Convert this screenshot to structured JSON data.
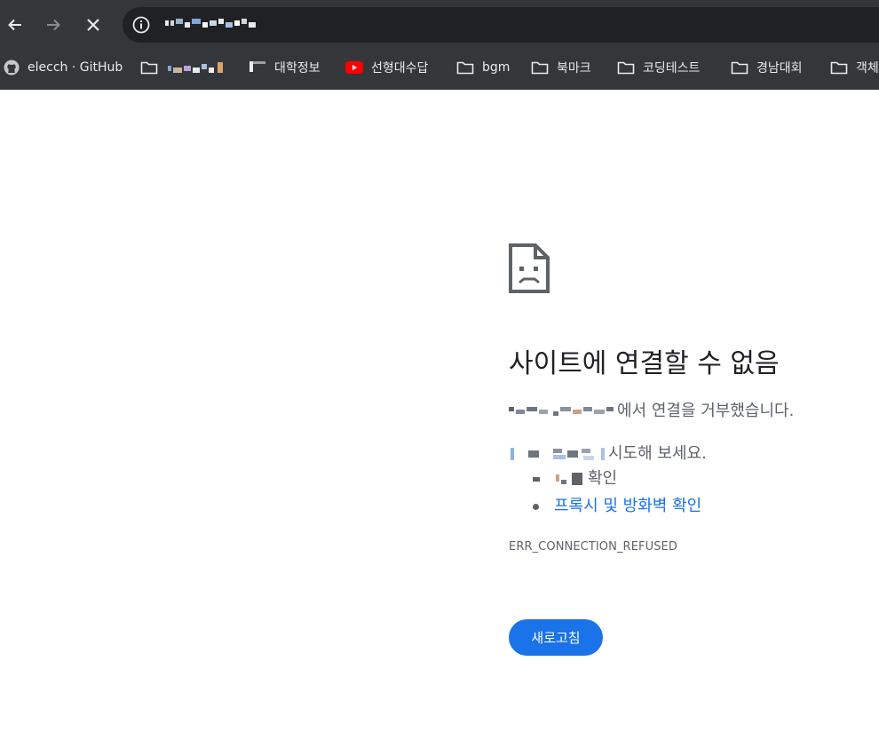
{
  "browser": {
    "url_text": "",
    "back_icon": "arrow-left-icon",
    "forward_icon": "arrow-right-icon",
    "stop_icon": "close-icon",
    "site_info_icon": "info-icon"
  },
  "bookmarks": [
    {
      "label": "elecch · GitHub",
      "icon": "github-icon"
    },
    {
      "label": "",
      "icon": "folder-icon"
    },
    {
      "label": "대학정보",
      "icon": "bookmark-favicon"
    },
    {
      "label": "선형대수답",
      "icon": "youtube-icon"
    },
    {
      "label": "bgm",
      "icon": "folder-icon"
    },
    {
      "label": "북마크",
      "icon": "folder-icon"
    },
    {
      "label": "코딩테스트",
      "icon": "folder-icon"
    },
    {
      "label": "경남대회",
      "icon": "folder-icon"
    },
    {
      "label": "객체",
      "icon": "folder-icon"
    }
  ],
  "error": {
    "icon": "sad-page-icon",
    "title": "사이트에 연결할 수 없음",
    "description_suffix": "에서 연결을 거부했습니다.",
    "try_suffix": "시도해 보세요.",
    "suggestions": [
      "확인",
      "프록시 및 방화벽 확인"
    ],
    "code": "ERR_CONNECTION_REFUSED",
    "reload_label": "새로고침"
  },
  "colors": {
    "toolbar_bg": "#35363a",
    "omnibox_bg": "#202124",
    "accent": "#1a73e8",
    "text_secondary": "#5f6368"
  }
}
